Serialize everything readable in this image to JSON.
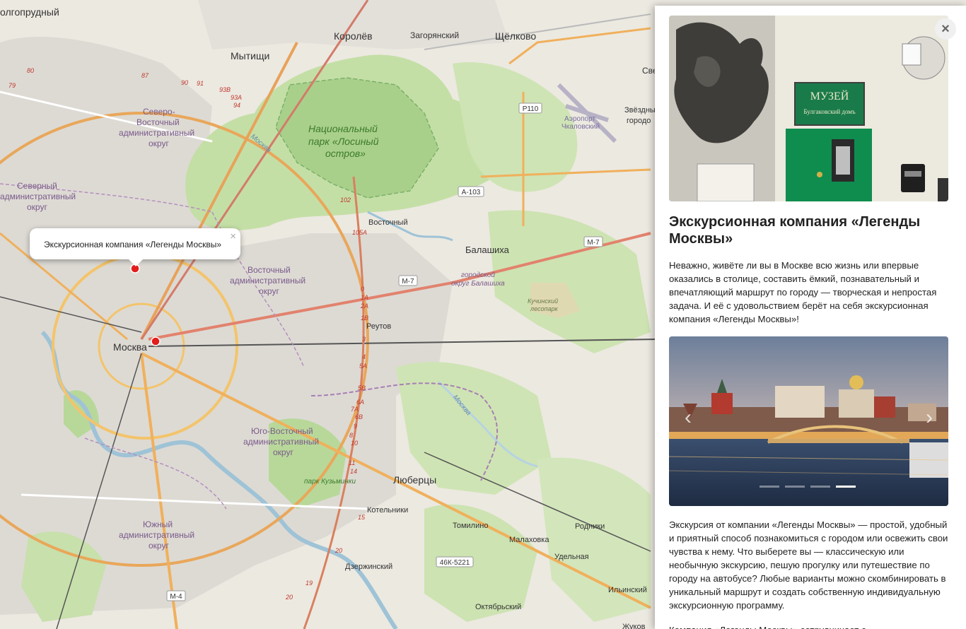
{
  "map": {
    "labels": {
      "dolgoprudny": "олгопрудный",
      "korolev": "Королёв",
      "zagoryansky": "Загорянский",
      "shchelkovo": "Щёлково",
      "mytishchi": "Мытищи",
      "sveltext": "Све",
      "airport1": "Аэропорт",
      "airport2": "Чкаловский",
      "zvezdny1": "Звёздны",
      "zvezdny2": "городо",
      "park1": "Национальный",
      "park2": "парк «Лосиный",
      "park3": "остров»",
      "svao1": "Северо-",
      "svao2": "Восточный",
      "svao3": "административный",
      "svao4": "округ",
      "sao1": "Северный",
      "sao2": "административный",
      "sao3": "округ",
      "moskva_river_n": "Москва",
      "vostochny": "Восточный",
      "balashikha": "Балашиха",
      "balashikha_okrug1": "городской",
      "balashikha_okrug2": "округ Балашиха",
      "vao1": "Восточный",
      "vao2": "административный",
      "vao3": "округ",
      "kuchinsky1": "Кучинский",
      "kuchinsky2": "лесопарк",
      "reutov": "Реутов",
      "moskva": "Москва",
      "uvao1": "Юго-Восточный",
      "uvao2": "административный",
      "uvao3": "округ",
      "moskva_river_e": "Москва",
      "park_kuzminki": "парк Кузьминки",
      "lyubertsy": "Люберцы",
      "kotelniki": "Котельники",
      "tomilino": "Томилино",
      "rodniki": "Родники",
      "malakhovka": "Малаховка",
      "udelnaya": "Удельная",
      "yuao1": "Южный",
      "yuao2": "административный",
      "yuao3": "округ",
      "dzerzhinsky": "Дзержинский",
      "ilinsky": "Ильинский",
      "oktyabrsky": "Октябрьский",
      "zhukov": "Жуков"
    },
    "road_shields": {
      "p110": "Р110",
      "a103": "А-103",
      "m7a": "М-7",
      "m7b": "М-7",
      "k46": "46К-5221",
      "m4": "М-4"
    },
    "exit_numbers": [
      "80",
      "79",
      "87",
      "90",
      "91",
      "93B",
      "93A",
      "94",
      "102",
      "105A",
      "0",
      "1A",
      "2A",
      "1B",
      "3",
      "4",
      "5A",
      "5B",
      "6A",
      "7A",
      "6B",
      "9",
      "8",
      "10",
      "11",
      "14",
      "15",
      "20",
      "19",
      "20"
    ],
    "marker_colors": {
      "marker": "#e31c1c"
    }
  },
  "popup": {
    "title": "Экскурсионная компания «Легенды Москвы»",
    "close": "×"
  },
  "panel": {
    "close": "×",
    "photo1": {
      "sign_line1": "МУЗЕЙ",
      "sign_line2": "Булгаковский домъ"
    },
    "title": "Экскурсионная компания «Легенды Москвы»",
    "intro": "Неважно, живёте ли вы в Москве всю жизнь или впервые оказались в столице, составить ёмкий, познавательный и впечатляющий маршрут по городу — творческая и непростая задача. И её с удовольствием берёт на себя экскурсионная компания «Легенды Москвы»!",
    "carousel": {
      "prev": "‹",
      "next": "›",
      "slide_count": 4,
      "active_index": 3
    },
    "body": "Экскурсия от компании «Легенды Москвы» — простой, удобный и приятный способ познакомиться с городом или освежить свои чувства к нему. Что выберете вы — классическую или необычную экскурсию, пешую прогулку или путешествие по городу на автобусе? Любые варианты можно скомбинировать в уникальный маршрут и создать собственную индивидуальную экскурсионную программу.",
    "more": "Компания «Легенды Москвы» сотрудничает с"
  }
}
